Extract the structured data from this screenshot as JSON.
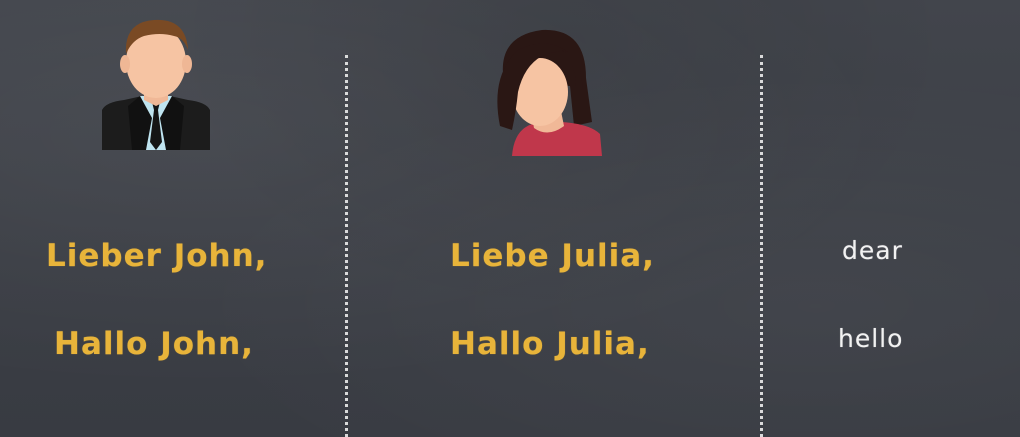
{
  "column1": {
    "avatar_icon": "businessman-avatar-icon",
    "line1": "Lieber John,",
    "line2": "Hallo John,"
  },
  "column2": {
    "avatar_icon": "woman-avatar-icon",
    "line1": "Liebe Julia,",
    "line2": "Hallo Julia,"
  },
  "column3": {
    "line1": "dear",
    "line2": "hello"
  },
  "colors": {
    "board": "#3d4047",
    "german_text": "#e8b43a",
    "english_text": "#f2f2f2",
    "divider": "#ebebeb"
  }
}
